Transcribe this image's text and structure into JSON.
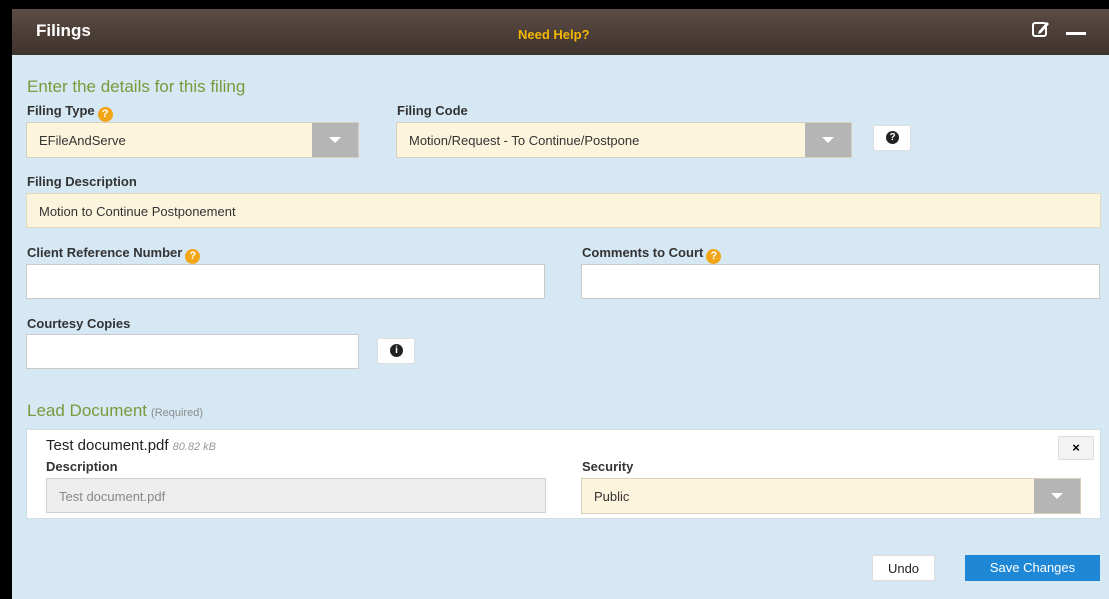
{
  "window": {
    "title": "Filings",
    "help_link": "Need Help?",
    "edit_icon": "edit-icon",
    "minimize_icon": "minimize-icon"
  },
  "form": {
    "section_title": "Enter the details for this filing",
    "filing_type": {
      "label": "Filing Type",
      "value": "EFileAndServe"
    },
    "filing_code": {
      "label": "Filing Code",
      "value": "Motion/Request - To Continue/Postpone"
    },
    "filing_description": {
      "label": "Filing Description",
      "value": "Motion to Continue Postponement"
    },
    "client_reference": {
      "label": "Client Reference Number",
      "value": ""
    },
    "comments_to_court": {
      "label": "Comments to Court",
      "value": ""
    },
    "courtesy_copies": {
      "label": "Courtesy Copies",
      "value": ""
    },
    "help_glyph": "?",
    "info_glyph": "i",
    "question_glyph": "?"
  },
  "lead_document": {
    "section_title": "Lead Document",
    "required_note": "(Required)",
    "file_name": "Test document.pdf",
    "file_size": "80.82 kB",
    "remove_glyph": "×",
    "description": {
      "label": "Description",
      "value": "Test document.pdf"
    },
    "security": {
      "label": "Security",
      "value": "Public"
    }
  },
  "actions": {
    "undo": "Undo",
    "save": "Save Changes"
  },
  "colors": {
    "titlebar": "#4a3d36",
    "panel": "#d5e8f4",
    "accent_green": "#7a9a3b",
    "help_yellow": "#f5b800",
    "save_blue": "#1e88d6"
  }
}
